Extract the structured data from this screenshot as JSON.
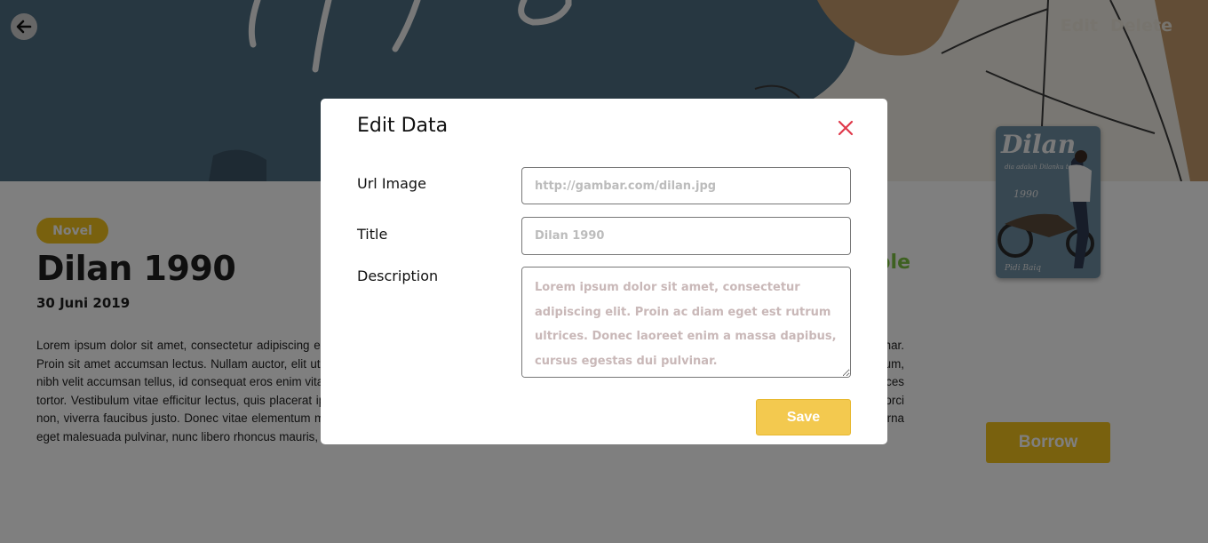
{
  "header": {
    "edit_label": "Edit",
    "delete_label": "Delete"
  },
  "book": {
    "genre": "Novel",
    "title": "Dilan 1990",
    "date": "30 Juni 2019",
    "status": "Available",
    "description": "Lorem ipsum dolor sit amet, consectetur adipiscing elit. Proin ac diam eget est rutrum ultrices. Donec laoreet enim a massa dapibus, cursus egestas dui pulvinar. Proin sit amet accumsan lectus. Nullam auctor, elit ut mollis tristique, est arcu egestas tellus, in ultricies mi enim vel metus. Phasellus sit amet interdum bibendum, nibh velit accumsan tellus, id consequat eros enim vitae nisi. Duis faucibus dapibus felis, in sagittis nulla ullamcorper vitae. Integer in euismod purus, sit amet ultrices tortor. Vestibulum vitae efficitur lectus, quis placerat ipsum. Quisque pretium laoreet odio, et consectetur odio malesuada sed. Phasellus orci sem, cursus nec orci non, viverra faucibus justo. Donec vitae elementum mauris, eget interdum nisl. Nulla luctus dignissim. Sed fringilla consequat ante vitae lobortis. Cras iaculis, urna eget malesuada pulvinar, nunc libero rhoncus mauris, nec massa.",
    "cover_title": "Dilan",
    "cover_subtitle": "dia adalah Dilanku tahun",
    "cover_year": "1990",
    "cover_author": "Pidi Baiq"
  },
  "borrow_label": "Borrow",
  "modal": {
    "title": "Edit Data",
    "url_label": "Url Image",
    "url_placeholder": "http://gambar.com/dilan.jpg",
    "title_label": "Title",
    "title_placeholder": "Dilan 1990",
    "description_label": "Description",
    "description_placeholder": "Lorem ipsum dolor sit amet, consectetur adipiscing elit. Proin ac diam eget est rutrum ultrices. Donec laoreet enim a massa dapibus, cursus egestas dui pulvinar.",
    "save_label": "Save"
  },
  "icons": {
    "back": "arrow-left-icon",
    "close": "close-icon"
  },
  "colors": {
    "accent": "#f3c21c",
    "save": "#f3c94f",
    "close": "#e0394a",
    "status": "#7cc242",
    "hero_bg": "#4f6e82"
  }
}
